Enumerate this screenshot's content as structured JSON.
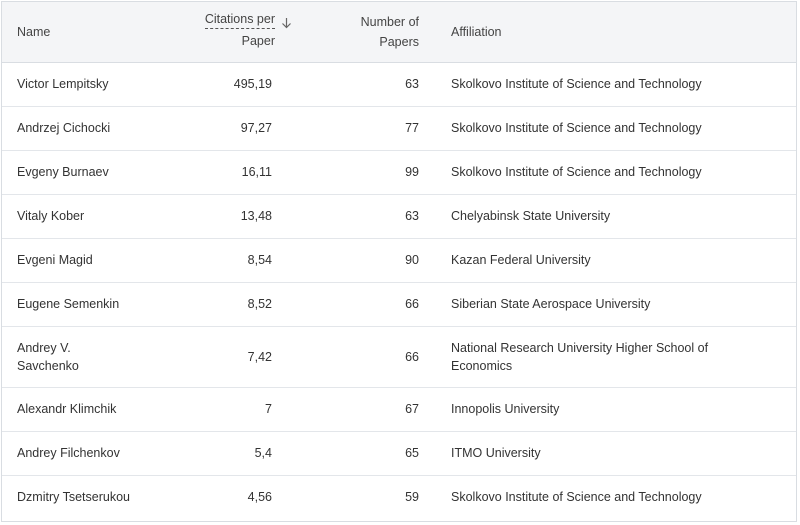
{
  "table": {
    "headers": {
      "name": "Name",
      "citations_line1": "Citations per",
      "citations_line2": "Paper",
      "papers_line1": "Number of",
      "papers_line2": "Papers",
      "affiliation": "Affiliation"
    },
    "sort_icon": "arrow-down-icon",
    "rows": [
      {
        "name": "Victor Lempitsky",
        "citations": "495,19",
        "papers": "63",
        "affiliation": "Skolkovo Institute of Science and Technology"
      },
      {
        "name": "Andrzej Cichocki",
        "citations": "97,27",
        "papers": "77",
        "affiliation": "Skolkovo Institute of Science and Technology"
      },
      {
        "name": "Evgeny Burnaev",
        "citations": "16,11",
        "papers": "99",
        "affiliation": "Skolkovo Institute of Science and Technology"
      },
      {
        "name": "Vitaly Kober",
        "citations": "13,48",
        "papers": "63",
        "affiliation": "Chelyabinsk State University"
      },
      {
        "name": "Evgeni Magid",
        "citations": "8,54",
        "papers": "90",
        "affiliation": "Kazan Federal University"
      },
      {
        "name": "Eugene Semenkin",
        "citations": "8,52",
        "papers": "66",
        "affiliation": "Siberian State Aerospace University"
      },
      {
        "name": "Andrey V. Savchenko",
        "citations": "7,42",
        "papers": "66",
        "affiliation": "National Research University Higher School of Economics"
      },
      {
        "name": "Alexandr Klimchik",
        "citations": "7",
        "papers": "67",
        "affiliation": "Innopolis University"
      },
      {
        "name": "Andrey Filchenkov",
        "citations": "5,4",
        "papers": "65",
        "affiliation": "ITMO University"
      },
      {
        "name": "Dzmitry Tsetserukou",
        "citations": "4,56",
        "papers": "59",
        "affiliation": "Skolkovo Institute of Science and Technology"
      }
    ]
  }
}
